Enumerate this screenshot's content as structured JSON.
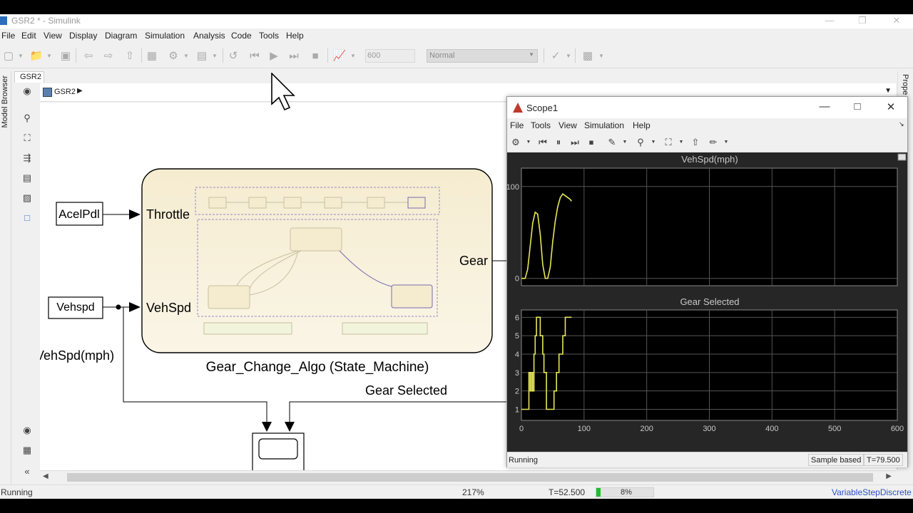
{
  "window": {
    "title": "GSR2 * - Simulink"
  },
  "menu": [
    "File",
    "Edit",
    "View",
    "Display",
    "Diagram",
    "Simulation",
    "Analysis",
    "Code",
    "Tools",
    "Help"
  ],
  "toolbar": {
    "stop_time": "600",
    "sim_mode": "Normal"
  },
  "tab": {
    "label": "GSR2"
  },
  "breadcrumb": {
    "label": "GSR2"
  },
  "left_panel": {
    "label": "Model Browser"
  },
  "right_panel": {
    "label": "Prope"
  },
  "diagram": {
    "block_acelpdl": "AcelPdl",
    "block_vehspd": "Vehspd",
    "port_throttle": "Throttle",
    "port_vehspd": "VehSpd",
    "port_gear": "Gear",
    "chart_caption": "Gear_Change_Algo (State_Machine)",
    "signal_vehspd_label": "VehSpd(mph)",
    "signal_gear_label": "Gear Selected"
  },
  "status": {
    "state": "Running",
    "zoom": "217%",
    "time": "T=52.500",
    "progress_pct": 8,
    "progress_label": "8%",
    "solver": "VariableStepDiscrete"
  },
  "scope": {
    "title": "Scope1",
    "menu": [
      "File",
      "Tools",
      "View",
      "Simulation",
      "Help"
    ],
    "status": "Running",
    "sample_mode": "Sample based",
    "time": "T=79.500"
  },
  "chart_data": [
    {
      "type": "line",
      "title": "VehSpd(mph)",
      "xlim": [
        0,
        600
      ],
      "ylim": [
        -8,
        120
      ],
      "xticks": [
        0,
        100,
        200,
        300,
        400,
        500,
        600
      ],
      "yticks": [
        0,
        100
      ],
      "grid": true,
      "line_color": "#e6e65a",
      "x": [
        0,
        6,
        10,
        14,
        18,
        22,
        26,
        30,
        34,
        38,
        42,
        46,
        50,
        54,
        58,
        62,
        66,
        70,
        74,
        78,
        80
      ],
      "y": [
        0,
        0,
        10,
        35,
        60,
        72,
        70,
        48,
        15,
        0,
        0,
        12,
        40,
        62,
        78,
        88,
        92,
        90,
        88,
        86,
        84
      ]
    },
    {
      "type": "line",
      "title": "Gear Selected",
      "xlim": [
        0,
        600
      ],
      "ylim": [
        0.4,
        6.4
      ],
      "xticks": [
        0,
        100,
        200,
        300,
        400,
        500,
        600
      ],
      "yticks": [
        1,
        2,
        3,
        4,
        5,
        6
      ],
      "grid": true,
      "line_color": "#e6e65a",
      "x": [
        0,
        12,
        12,
        14,
        14,
        16,
        16,
        18,
        18,
        20,
        20,
        22,
        22,
        24,
        24,
        26,
        26,
        30,
        30,
        34,
        34,
        36,
        36,
        40,
        40,
        52,
        52,
        56,
        56,
        60,
        60,
        66,
        66,
        70,
        70,
        76,
        76,
        80
      ],
      "y": [
        1,
        1,
        3,
        3,
        2,
        2,
        3,
        3,
        2,
        2,
        4,
        4,
        5,
        5,
        6,
        6,
        6,
        6,
        5,
        5,
        4,
        4,
        3,
        3,
        1,
        1,
        2,
        2,
        3,
        3,
        4,
        4,
        5,
        5,
        6,
        6,
        6,
        6
      ]
    }
  ]
}
